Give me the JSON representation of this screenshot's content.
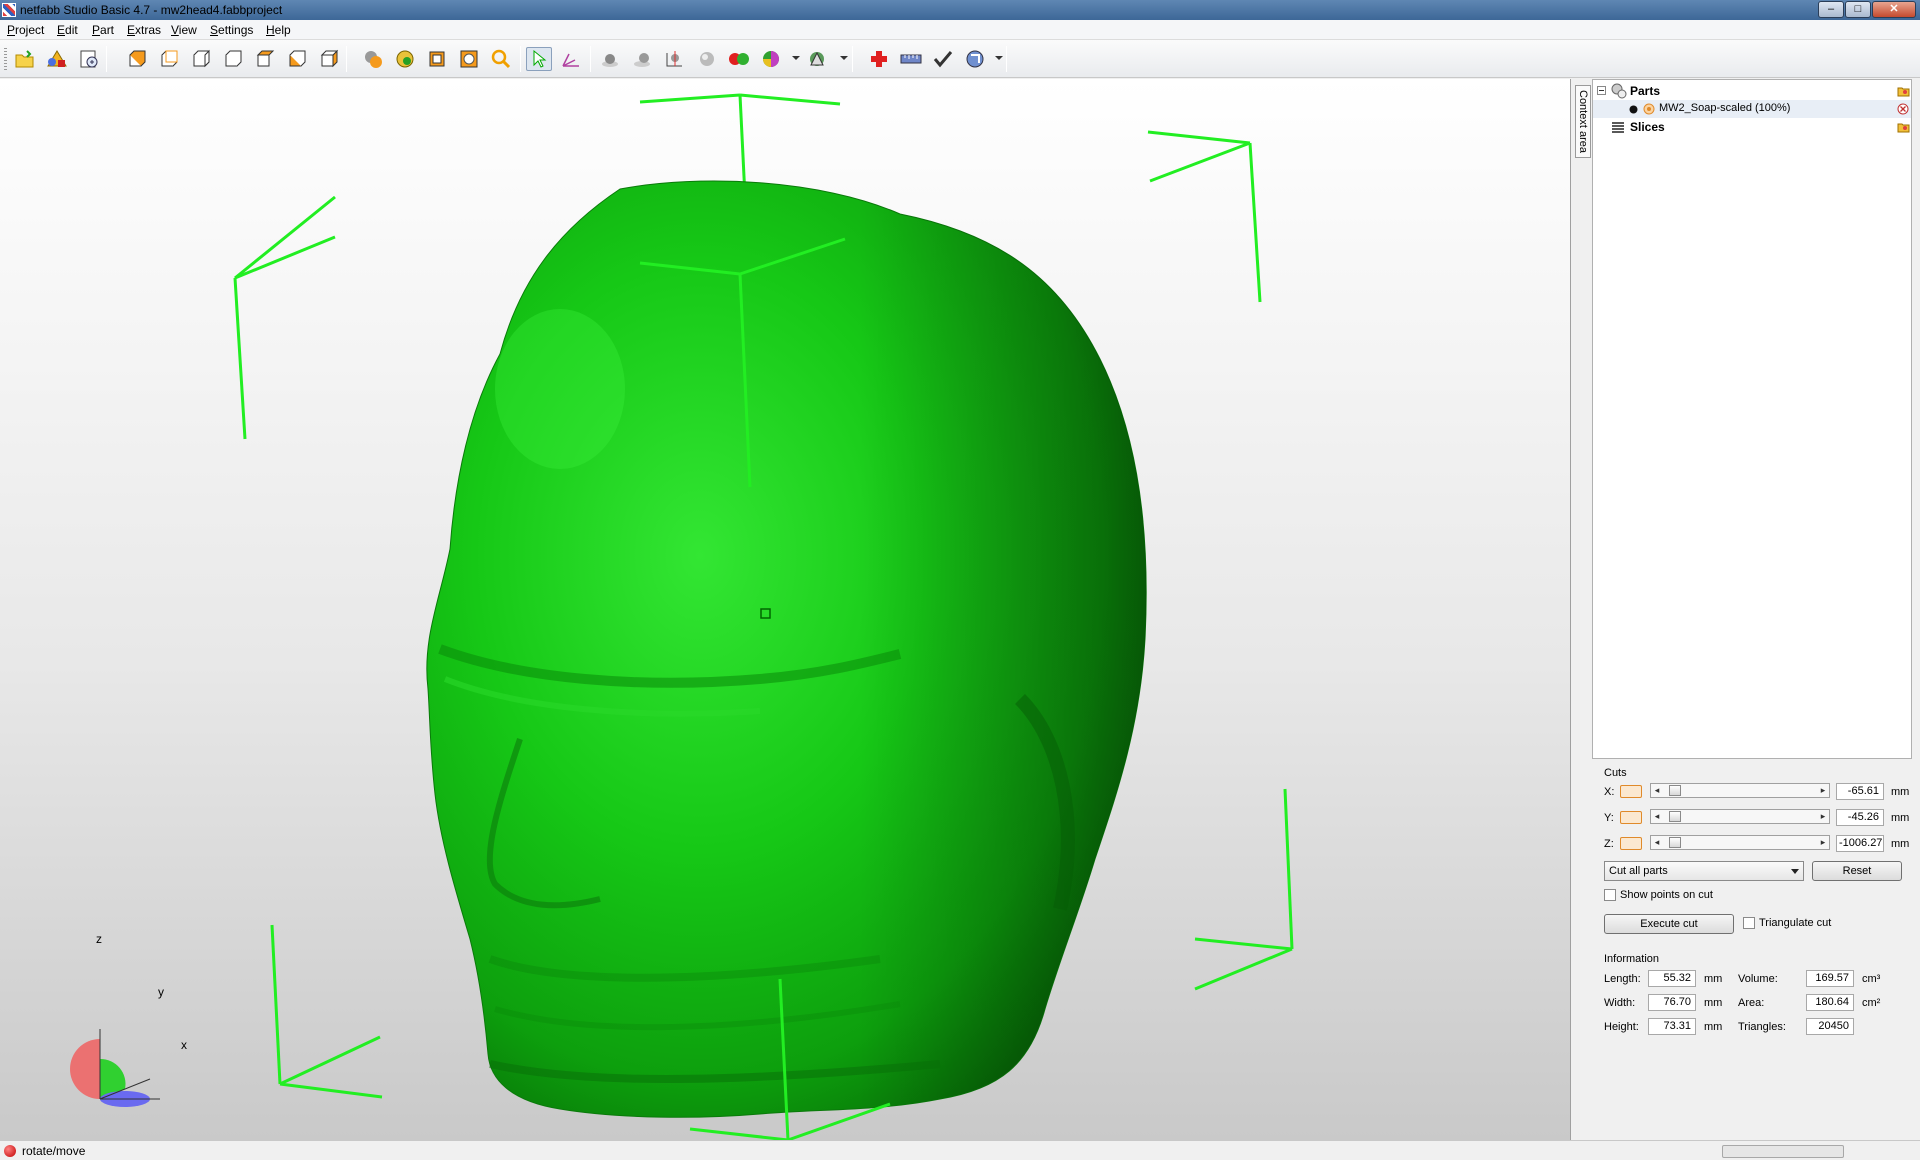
{
  "window": {
    "title": "netfabb Studio Basic 4.7 - mw2head4.fabbproject",
    "minimize": "–",
    "maximize": "□",
    "close": "✕"
  },
  "menu": [
    "Project",
    "Edit",
    "Part",
    "Extras",
    "View",
    "Settings",
    "Help"
  ],
  "side_tab": {
    "label": "Context area"
  },
  "tree": {
    "parts_label": "Parts",
    "part_item": "MW2_Soap-scaled (100%)",
    "slices_label": "Slices"
  },
  "cuts": {
    "group_label": "Cuts",
    "x": {
      "label": "X:",
      "value": "-65.61",
      "unit": "mm"
    },
    "y": {
      "label": "Y:",
      "value": "-45.26",
      "unit": "mm"
    },
    "z": {
      "label": "Z:",
      "value": "-1006.27",
      "unit": "mm"
    },
    "mode_selected": "Cut all parts",
    "reset_label": "Reset",
    "show_points_label": "Show points on cut",
    "execute_label": "Execute cut",
    "triangulate_label": "Triangulate cut"
  },
  "information": {
    "group_label": "Information",
    "length": {
      "label": "Length:",
      "value": "55.32",
      "unit": "mm"
    },
    "width": {
      "label": "Width:",
      "value": "76.70",
      "unit": "mm"
    },
    "height": {
      "label": "Height:",
      "value": "73.31",
      "unit": "mm"
    },
    "volume": {
      "label": "Volume:",
      "value": "169.57",
      "unit": "cm³"
    },
    "area": {
      "label": "Area:",
      "value": "180.64",
      "unit": "cm²"
    },
    "triangles": {
      "label": "Triangles:",
      "value": "20450"
    }
  },
  "axes": {
    "z": "z",
    "y": "y",
    "x": "x"
  },
  "status": {
    "text": "rotate/move"
  },
  "colors": {
    "model": "#1ec31e",
    "bbox": "#22ee22",
    "accent": "#e08a2a"
  },
  "icons": {
    "toolbar": [
      "open-folder-icon",
      "add-part-icon",
      "part-properties-icon",
      "view-front-icon",
      "view-back-icon",
      "view-left-icon",
      "view-right-icon",
      "view-top-icon",
      "view-bottom-icon",
      "view-iso-icon",
      "shade-icon",
      "color-icon",
      "wireframe-icon",
      "texture-icon",
      "zoom-icon",
      "select-arrow-icon",
      "rotate-move-icon",
      "measure-icon",
      "dimension-icon",
      "align-icon",
      "sphere-icon",
      "colored-spheres-icon",
      "sections-icon",
      "view-pick-icon",
      "repair-cross-icon",
      "ruler-icon",
      "check-icon",
      "help-icon"
    ]
  }
}
